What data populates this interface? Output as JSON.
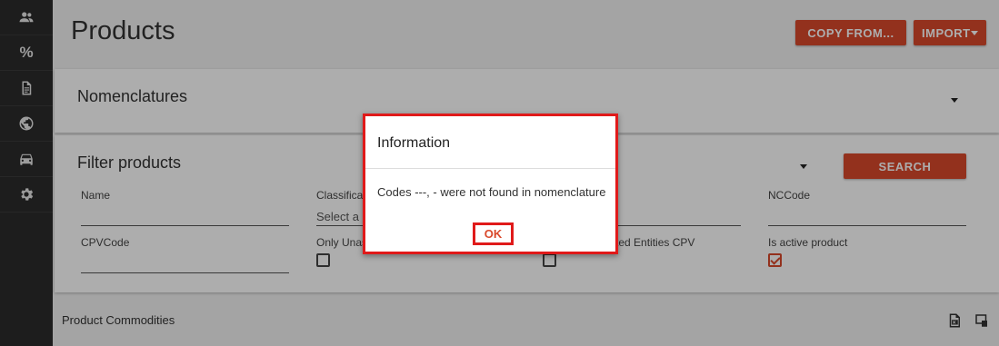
{
  "sidebar": {
    "items": [
      {
        "icon": "users-icon"
      },
      {
        "icon": "percent-icon",
        "symbol": "%"
      },
      {
        "icon": "document-icon"
      },
      {
        "icon": "globe-icon"
      },
      {
        "icon": "car-icon"
      },
      {
        "icon": "gear-icon"
      }
    ]
  },
  "header": {
    "title": "Products",
    "copy_from_label": "COPY FROM...",
    "import_label": "IMPORT"
  },
  "nomenclatures": {
    "title": "Nomenclatures"
  },
  "filter": {
    "title": "Filter products",
    "search_label": "SEARCH",
    "fields": {
      "name_label": "Name",
      "classification_label": "Classificat",
      "classification_placeholder": "Select a",
      "nccode_label": "NCCode",
      "cpvcode_label": "CPVCode",
      "only_unassigned_label": "Only Unas",
      "related_entities_label": "ted Entities CPV",
      "is_active_label": "Is active product"
    },
    "checkboxes": {
      "only_unassigned": false,
      "related_entities": false,
      "is_active": true
    }
  },
  "commodities": {
    "title": "Product Commodities"
  },
  "dialog": {
    "title": "Information",
    "message": "Codes ---, - were not found in nomenclature",
    "ok_label": "OK"
  },
  "colors": {
    "accent": "#d9492b",
    "sidebar_bg": "#2b2b2b",
    "highlight": "#e01a1a"
  }
}
